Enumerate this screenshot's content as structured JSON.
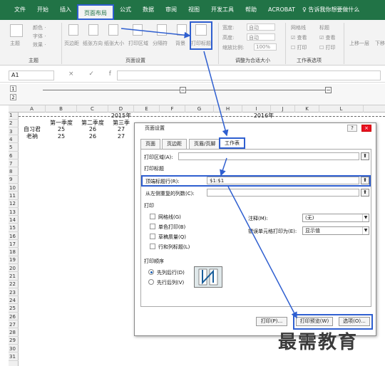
{
  "ribbon_tabs": [
    "文件",
    "开始",
    "插入",
    "页面布局",
    "公式",
    "数据",
    "审阅",
    "视图",
    "开发工具",
    "帮助",
    "ACROBAT"
  ],
  "tell_me": "告诉我你想要做什么",
  "ribbon": {
    "theme_btn": "主题",
    "theme_colors": "颜色 ·",
    "theme_fonts": "字体 ·",
    "theme_effects": "效果 ·",
    "theme_group": "主题",
    "page_margins": "页边距",
    "page_orientation": "纸张方向",
    "page_size": "纸张大小",
    "print_area": "打印区域",
    "page_breaks": "分隔符",
    "background": "背景",
    "print_titles": "打印标题",
    "page_setup_group": "页面设置",
    "width_label": "宽度:",
    "height_label": "高度:",
    "width_value": "自动",
    "height_value": "自动",
    "scale_label": "缩放比例:",
    "scale_value": "100%",
    "scale_group": "调整为合适大小",
    "gridlines_label": "网格线",
    "headings_label": "标题",
    "gridlines_view": "查看",
    "gridlines_print": "打印",
    "headings_view": "查看",
    "headings_print": "打印",
    "sheet_options_group": "工作表选项",
    "bring_forward": "上移一层",
    "send_backward": "下移"
  },
  "formula_bar": {
    "name_box": "A1",
    "fx_symbols": "× ✓ fx"
  },
  "columns": [
    "A",
    "B",
    "C",
    "D",
    "E",
    "F",
    "G",
    "H",
    "I",
    "J",
    "K",
    "L"
  ],
  "rows": [
    "1",
    "2",
    "3",
    "4",
    "5",
    "6",
    "7",
    "8",
    "9",
    "10",
    "11",
    "12",
    "13",
    "14",
    "15",
    "16",
    "17",
    "18",
    "19",
    "20",
    "21",
    "22",
    "23",
    "24",
    "25",
    "26",
    "27",
    "28",
    "29",
    "30",
    "31"
  ],
  "outline": {
    "level1": "1",
    "level2": "2",
    "collapse": "−"
  },
  "cells": {
    "r1_year1": "2015年",
    "r1_year2": "2016年",
    "r2_q1": "第一季度",
    "r2_q2": "第二季度",
    "r2_q3": "第三季",
    "r3_name": "自习君",
    "r3_q1": "25",
    "r3_q2": "26",
    "r3_q3": "27",
    "r4_name": "老衲",
    "r4_q1": "25",
    "r4_q2": "26",
    "r4_q3": "27"
  },
  "dialog": {
    "title": "页面设置",
    "help": "?",
    "close": "×",
    "tabs": [
      "页面",
      "页边距",
      "页眉/页脚",
      "工作表"
    ],
    "print_area_label": "打印区域(A):",
    "print_titles_heading": "打印标题",
    "rows_repeat_label": "顶端标题行(R):",
    "rows_repeat_value": "$1:$1",
    "cols_repeat_label": "从左侧重复的列数(C):",
    "print_heading": "打印",
    "gridlines": "网格线(G)",
    "bw": "单色打印(B)",
    "draft": "草稿质量(Q)",
    "rowcol_headings": "行和列标题(L)",
    "comments_label": "注释(M):",
    "comments_value": "(无)",
    "errors_label": "错误单元格打印为(E):",
    "errors_value": "显示值",
    "page_order_heading": "打印顺序",
    "down_then_over": "先列后行(D)",
    "over_then_down": "先行后列(V)",
    "btn_print": "打印(P)...",
    "btn_preview": "打印预览(W)",
    "btn_options": "选项(O)...",
    "up_arrow": "⬆"
  },
  "watermark": "最需教育"
}
